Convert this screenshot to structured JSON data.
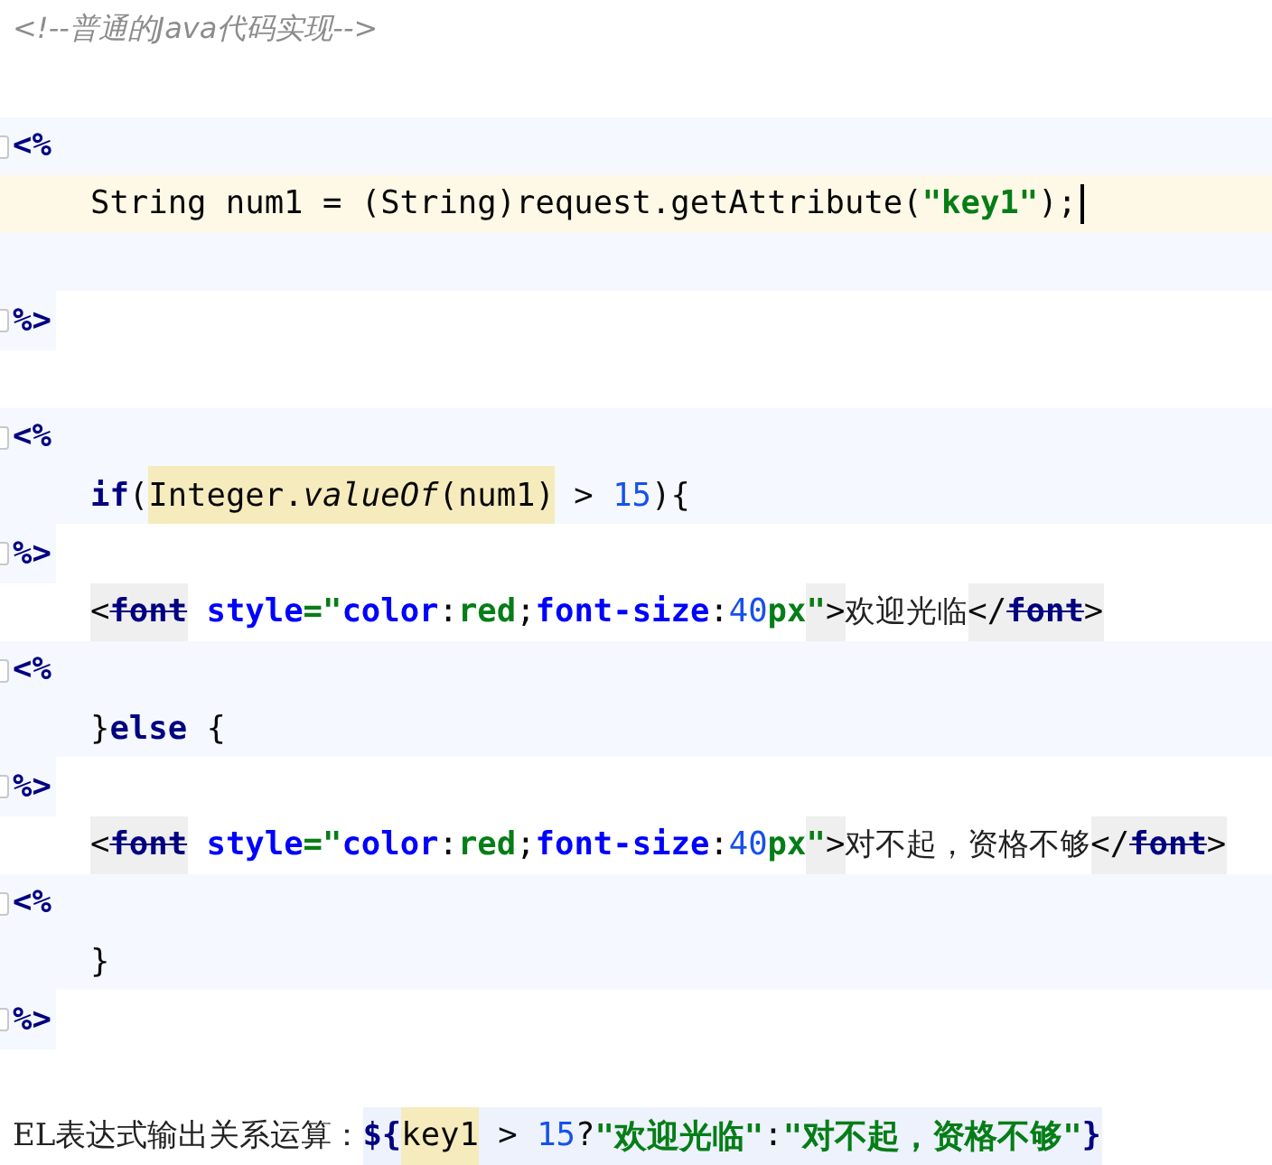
{
  "editor": {
    "lines": [
      {
        "kind": "html",
        "indent": false,
        "current": false,
        "tokens": [
          {
            "text": "<!--普通的Java代码实现-->",
            "kind": "comment"
          }
        ]
      },
      {
        "kind": "html",
        "indent": false,
        "current": false
      },
      {
        "kind": "open",
        "indent": false,
        "current": false,
        "tokens": [
          {
            "text": "<%",
            "kind": "delim"
          }
        ]
      },
      {
        "kind": "java",
        "indent": true,
        "current": true,
        "tokens": [
          {
            "text": "String num1 = (String)request.getAttribute(",
            "kind": "plain"
          },
          {
            "text": "\"key1\"",
            "kind": "string"
          },
          {
            "text": ");",
            "kind": "plain"
          }
        ]
      },
      {
        "kind": "java",
        "indent": false,
        "current": false
      },
      {
        "kind": "close",
        "indent": false,
        "current": false,
        "tokens": [
          {
            "text": "%>",
            "kind": "delim"
          }
        ]
      },
      {
        "kind": "html",
        "indent": false,
        "current": false
      },
      {
        "kind": "open",
        "indent": false,
        "current": false,
        "tokens": [
          {
            "text": "<%",
            "kind": "delim"
          }
        ]
      },
      {
        "kind": "java",
        "indent": true,
        "current": false,
        "tokens": [
          {
            "text": "if",
            "kind": "keyword"
          },
          {
            "text": "(",
            "kind": "plain"
          },
          {
            "text": "Integer.",
            "kind": "plain",
            "usage_highlight": true
          },
          {
            "text": "valueOf",
            "kind": "method",
            "usage_highlight": true
          },
          {
            "text": "(num1)",
            "kind": "plain",
            "usage_highlight": true
          },
          {
            "text": " > ",
            "kind": "plain"
          },
          {
            "text": "15",
            "kind": "number"
          },
          {
            "text": "){",
            "kind": "plain"
          }
        ]
      },
      {
        "kind": "close",
        "indent": false,
        "current": false,
        "tokens": [
          {
            "text": "%>",
            "kind": "delim"
          }
        ]
      },
      {
        "kind": "html",
        "indent": true,
        "current": false,
        "tokens": [
          {
            "text": "<",
            "kind": "plain",
            "tag_highlight": true
          },
          {
            "text": "font",
            "kind": "tagname",
            "tag_highlight": true
          },
          {
            "text": " style",
            "kind": "attr"
          },
          {
            "text": "=\"",
            "kind": "string"
          },
          {
            "text": "color",
            "kind": "attr"
          },
          {
            "text": ":",
            "kind": "plain"
          },
          {
            "text": "red",
            "kind": "value"
          },
          {
            "text": ";",
            "kind": "plain"
          },
          {
            "text": "font-size",
            "kind": "attr"
          },
          {
            "text": ":",
            "kind": "plain"
          },
          {
            "text": "40",
            "kind": "number"
          },
          {
            "text": "px",
            "kind": "value"
          },
          {
            "text": "\"",
            "kind": "string",
            "tag_highlight": true
          },
          {
            "text": ">",
            "kind": "plain",
            "tag_highlight": true
          },
          {
            "text": "欢迎光临",
            "kind": "cjk"
          },
          {
            "text": "</",
            "kind": "plain",
            "tag_highlight": true
          },
          {
            "text": "font",
            "kind": "tagname",
            "tag_highlight": true
          },
          {
            "text": ">",
            "kind": "plain",
            "tag_highlight": true
          }
        ]
      },
      {
        "kind": "open",
        "indent": false,
        "current": false,
        "tokens": [
          {
            "text": "<%",
            "kind": "delim"
          }
        ]
      },
      {
        "kind": "java",
        "indent": true,
        "current": false,
        "tokens": [
          {
            "text": "}",
            "kind": "plain"
          },
          {
            "text": "else",
            "kind": "keyword"
          },
          {
            "text": " {",
            "kind": "plain"
          }
        ]
      },
      {
        "kind": "close",
        "indent": false,
        "current": false,
        "tokens": [
          {
            "text": "%>",
            "kind": "delim"
          }
        ]
      },
      {
        "kind": "html",
        "indent": true,
        "current": false,
        "tokens": [
          {
            "text": "<",
            "kind": "plain",
            "tag_highlight": true
          },
          {
            "text": "font",
            "kind": "tagname",
            "tag_highlight": true
          },
          {
            "text": " style",
            "kind": "attr"
          },
          {
            "text": "=\"",
            "kind": "string"
          },
          {
            "text": "color",
            "kind": "attr"
          },
          {
            "text": ":",
            "kind": "plain"
          },
          {
            "text": "red",
            "kind": "value"
          },
          {
            "text": ";",
            "kind": "plain"
          },
          {
            "text": "font-size",
            "kind": "attr"
          },
          {
            "text": ":",
            "kind": "plain"
          },
          {
            "text": "40",
            "kind": "number"
          },
          {
            "text": "px",
            "kind": "value"
          },
          {
            "text": "\"",
            "kind": "string",
            "tag_highlight": true
          },
          {
            "text": ">",
            "kind": "plain",
            "tag_highlight": true
          },
          {
            "text": "对不起，资格不够",
            "kind": "cjk"
          },
          {
            "text": "</",
            "kind": "plain",
            "tag_highlight": true
          },
          {
            "text": "font",
            "kind": "tagname",
            "tag_highlight": true
          },
          {
            "text": ">",
            "kind": "plain",
            "tag_highlight": true
          }
        ]
      },
      {
        "kind": "open",
        "indent": false,
        "current": false,
        "tokens": [
          {
            "text": "<%",
            "kind": "delim"
          }
        ]
      },
      {
        "kind": "java",
        "indent": true,
        "current": false,
        "tokens": [
          {
            "text": "}",
            "kind": "plain"
          }
        ]
      },
      {
        "kind": "close",
        "indent": false,
        "current": false,
        "tokens": [
          {
            "text": "%>",
            "kind": "delim"
          }
        ]
      },
      {
        "kind": "html",
        "indent": false,
        "current": false
      },
      {
        "kind": "html",
        "indent": false,
        "current": false,
        "tokens": [
          {
            "text": "EL表达式输出关系运算：",
            "kind": "cjk"
          },
          {
            "text": "${",
            "kind": "delim",
            "el_region": true
          },
          {
            "text": "key1",
            "kind": "plain",
            "usage_highlight": true
          },
          {
            "text": " > ",
            "kind": "plain",
            "el_region": true
          },
          {
            "text": "15",
            "kind": "number",
            "el_region": true
          },
          {
            "text": "?",
            "kind": "plain",
            "el_region": true
          },
          {
            "text": "\"欢迎光临\"",
            "kind": "string",
            "el_region": true
          },
          {
            "text": ":",
            "kind": "plain",
            "el_region": true
          },
          {
            "text": "\"对不起，资格不够\"",
            "kind": "string",
            "el_region": true
          },
          {
            "text": "}",
            "kind": "delim",
            "el_region": true
          }
        ]
      }
    ]
  }
}
